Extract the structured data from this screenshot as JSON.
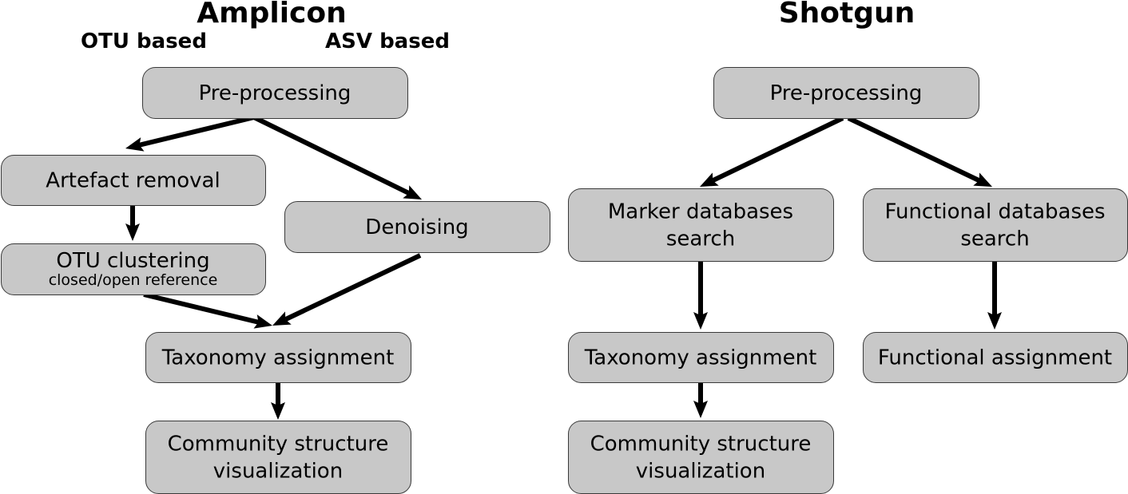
{
  "sections": [
    {
      "id": "amplicon",
      "title": "Amplicon",
      "subtitles": [
        "OTU based",
        "ASV based"
      ],
      "nodes": [
        {
          "id": "a-pre",
          "lines": [
            "Pre-processing"
          ]
        },
        {
          "id": "a-artefact",
          "lines": [
            "Artefact removal"
          ]
        },
        {
          "id": "a-denoise",
          "lines": [
            "Denoising"
          ]
        },
        {
          "id": "a-otu",
          "lines": [
            "OTU clustering"
          ],
          "sublines": [
            "closed/open reference"
          ]
        },
        {
          "id": "a-tax",
          "lines": [
            "Taxonomy assignment"
          ]
        },
        {
          "id": "a-comm",
          "lines": [
            "Community structure",
            "visualization"
          ]
        }
      ],
      "edges": [
        {
          "from": "a-pre",
          "to": "a-artefact"
        },
        {
          "from": "a-pre",
          "to": "a-denoise"
        },
        {
          "from": "a-artefact",
          "to": "a-otu"
        },
        {
          "from": "a-otu",
          "to": "a-tax"
        },
        {
          "from": "a-denoise",
          "to": "a-tax"
        },
        {
          "from": "a-tax",
          "to": "a-comm"
        }
      ]
    },
    {
      "id": "shotgun",
      "title": "Shotgun",
      "subtitles": [],
      "nodes": [
        {
          "id": "s-pre",
          "lines": [
            "Pre-processing"
          ]
        },
        {
          "id": "s-marker",
          "lines": [
            "Marker databases",
            "search"
          ]
        },
        {
          "id": "s-func",
          "lines": [
            "Functional databases",
            "search"
          ]
        },
        {
          "id": "s-tax",
          "lines": [
            "Taxonomy assignment"
          ]
        },
        {
          "id": "s-funcassign",
          "lines": [
            "Functional assignment"
          ]
        },
        {
          "id": "s-comm",
          "lines": [
            "Community structure",
            "visualization"
          ]
        }
      ],
      "edges": [
        {
          "from": "s-pre",
          "to": "s-marker"
        },
        {
          "from": "s-pre",
          "to": "s-func"
        },
        {
          "from": "s-marker",
          "to": "s-tax"
        },
        {
          "from": "s-func",
          "to": "s-funcassign"
        },
        {
          "from": "s-tax",
          "to": "s-comm"
        }
      ]
    }
  ]
}
